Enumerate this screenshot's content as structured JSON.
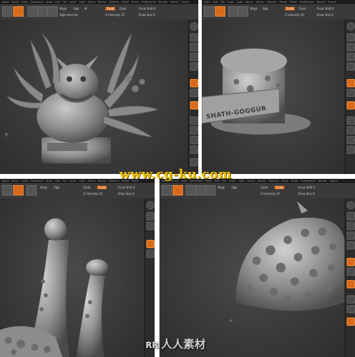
{
  "app": {
    "menu_items": [
      "Alpha",
      "Brush",
      "Color",
      "Document",
      "Draw",
      "Edit",
      "File",
      "Layer",
      "Light",
      "Macro",
      "Marker",
      "Material",
      "Movie",
      "Picker",
      "Preferences",
      "Render",
      "Stencil",
      "Stroke",
      "Texture",
      "Tool",
      "Transform",
      "Zplugin",
      "Zscript"
    ],
    "toolbar": {
      "mrgb": "Mrgb",
      "rgb": "Rgb",
      "m": "M",
      "zadd": "Zadd",
      "zsub": "Zsub",
      "focal_shift": "Focal Shift 0",
      "draw_size": "Draw Size 6",
      "z_intensity": "Z Intensity 25",
      "rgb_intensity": "Rgb Intensity"
    }
  },
  "watermarks": {
    "site": "www.cg-ku.com",
    "brand": "人人素材",
    "brand_logo": "RR"
  },
  "colors": {
    "accent": "#d86a1c",
    "watermark_yellow": "#f2c200",
    "viewport_bg": "#3b3b3b"
  },
  "panels": [
    {
      "id": "top-left",
      "subject": "creature bust with tentacles"
    },
    {
      "id": "top-right",
      "subject": "sculpted plinth with nameplate",
      "nameplate_text": "SHATH-GOGGUR"
    },
    {
      "id": "bottom-left",
      "subject": "close-up of tentacle tips"
    },
    {
      "id": "bottom-right",
      "subject": "close-up of textured head"
    }
  ]
}
